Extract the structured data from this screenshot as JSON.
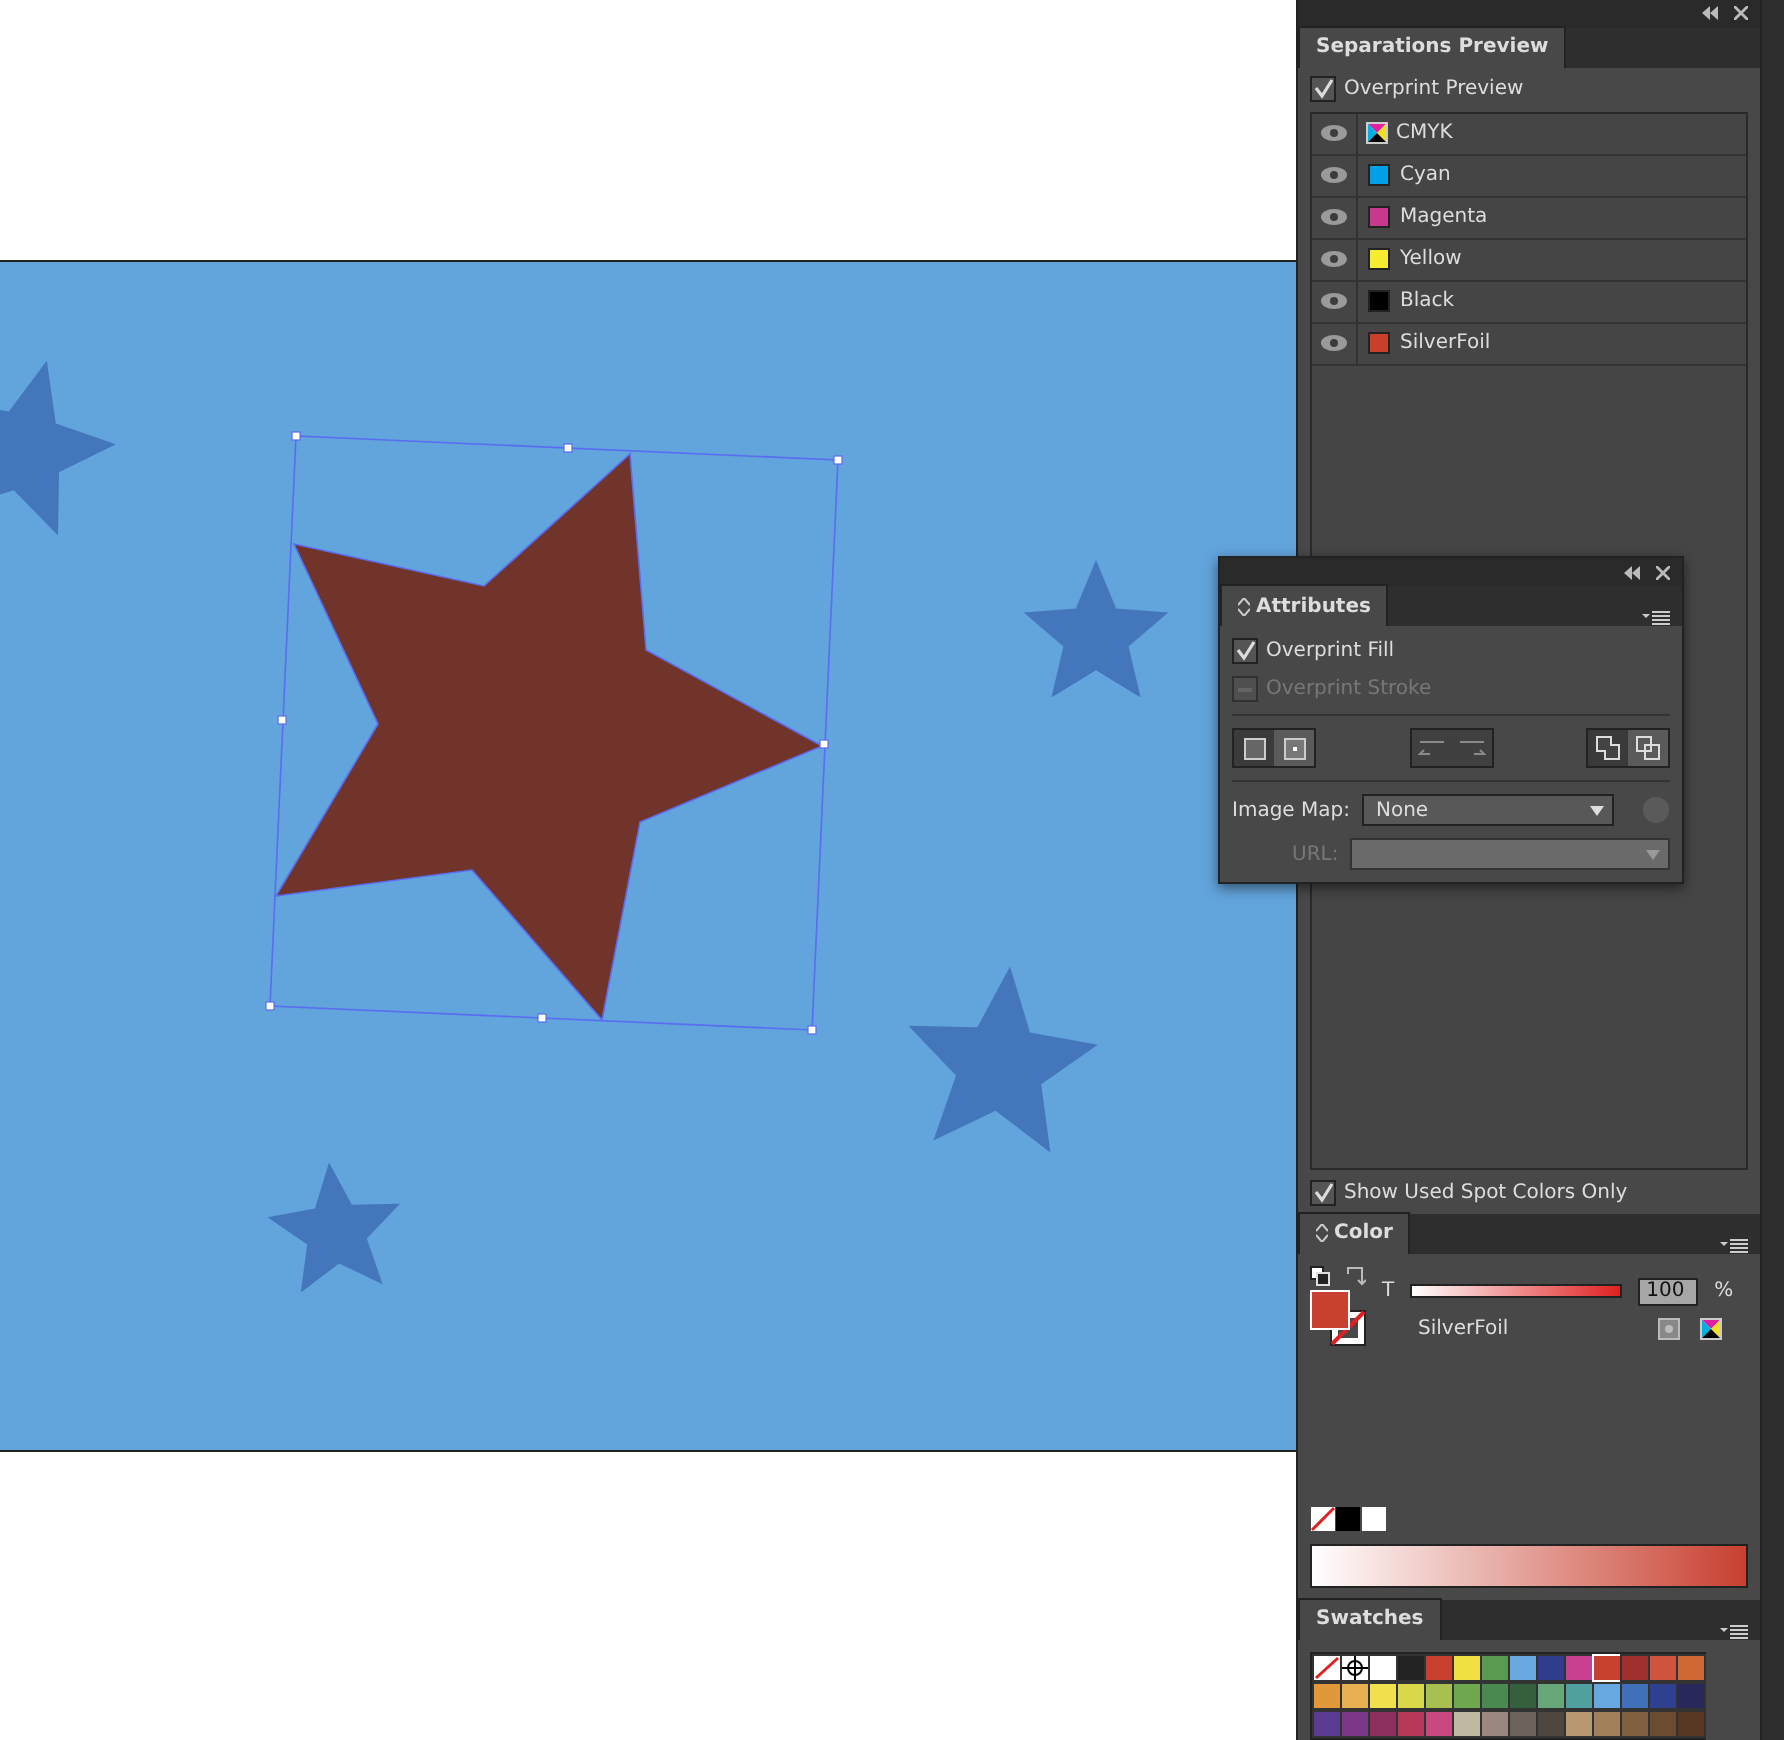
{
  "separations": {
    "title": "Separations Preview",
    "overprint_preview": {
      "label": "Overprint Preview",
      "checked": true
    },
    "inks": [
      {
        "name": "CMYK",
        "kind": "process",
        "visible": true
      },
      {
        "name": "Cyan",
        "kind": "ink",
        "color": "#00a0e6",
        "visible": true
      },
      {
        "name": "Magenta",
        "kind": "ink",
        "color": "#c8388c",
        "visible": true
      },
      {
        "name": "Yellow",
        "kind": "ink",
        "color": "#f8ec30",
        "visible": true
      },
      {
        "name": "Black",
        "kind": "ink",
        "color": "#000000",
        "visible": true
      },
      {
        "name": "SilverFoil",
        "kind": "ink",
        "color": "#c8402c",
        "visible": true
      }
    ],
    "show_used_spot": {
      "label": "Show Used Spot Colors Only",
      "checked": true
    }
  },
  "attributes": {
    "title": "Attributes",
    "overprint_fill": {
      "label": "Overprint Fill",
      "checked": true,
      "disabled": false
    },
    "overprint_stroke": {
      "label": "Overprint Stroke",
      "checked": false,
      "disabled": true
    },
    "image_map_label": "Image Map:",
    "image_map_value": "None",
    "url_label": "URL:"
  },
  "color": {
    "title": "Color",
    "tint_label": "T",
    "level": 1,
    "value": "100",
    "unit": "%",
    "swatch_name": "SilverFoil"
  },
  "swatches": {
    "title": "Swatches",
    "items": [
      {
        "kind": "none",
        "selected": false
      },
      {
        "kind": "registration",
        "selected": false
      },
      {
        "kind": "color",
        "color": "#ffffff",
        "selected": false
      },
      {
        "kind": "color",
        "color": "#222222",
        "selected": false
      },
      {
        "kind": "color",
        "color": "#c8412f",
        "selected": false
      },
      {
        "kind": "color",
        "color": "#f0e040",
        "selected": false
      },
      {
        "kind": "color",
        "color": "#5a9a50",
        "selected": false
      },
      {
        "kind": "color",
        "color": "#6aa8e0",
        "selected": false
      },
      {
        "kind": "color",
        "color": "#303c8c",
        "selected": false
      },
      {
        "kind": "color",
        "color": "#c84090",
        "selected": false
      },
      {
        "kind": "color",
        "color": "#c84030",
        "selected": true
      },
      {
        "kind": "color",
        "color": "#a03030",
        "selected": false
      },
      {
        "kind": "color",
        "color": "#d05540",
        "selected": false
      },
      {
        "kind": "color",
        "color": "#d06a35",
        "selected": false
      },
      {
        "kind": "color",
        "color": "#e0983a",
        "selected": false
      },
      {
        "kind": "color",
        "color": "#e8b050",
        "selected": false
      },
      {
        "kind": "color",
        "color": "#f0e050",
        "selected": false
      },
      {
        "kind": "color",
        "color": "#d8d848",
        "selected": false
      },
      {
        "kind": "color",
        "color": "#a8c050",
        "selected": false
      },
      {
        "kind": "color",
        "color": "#70a850",
        "selected": false
      },
      {
        "kind": "color",
        "color": "#4a8a50",
        "selected": false
      },
      {
        "kind": "color",
        "color": "#36603c",
        "selected": false
      },
      {
        "kind": "color",
        "color": "#68a878",
        "selected": false
      },
      {
        "kind": "color",
        "color": "#50a0a0",
        "selected": false
      },
      {
        "kind": "color",
        "color": "#68a8e0",
        "selected": false
      },
      {
        "kind": "color",
        "color": "#4070b8",
        "selected": false
      },
      {
        "kind": "color",
        "color": "#304090",
        "selected": false
      },
      {
        "kind": "color",
        "color": "#28285c",
        "selected": false
      },
      {
        "kind": "color",
        "color": "#5c3c90",
        "selected": false
      },
      {
        "kind": "color",
        "color": "#7c3888",
        "selected": false
      },
      {
        "kind": "color",
        "color": "#8c3060",
        "selected": false
      },
      {
        "kind": "color",
        "color": "#b83858",
        "selected": false
      },
      {
        "kind": "color",
        "color": "#c84880",
        "selected": false
      },
      {
        "kind": "color",
        "color": "#c0b8a0",
        "selected": false
      },
      {
        "kind": "color",
        "color": "#988880",
        "selected": false
      },
      {
        "kind": "color",
        "color": "#6c645c",
        "selected": false
      },
      {
        "kind": "color",
        "color": "#504640",
        "selected": false
      },
      {
        "kind": "color",
        "color": "#b89870",
        "selected": false
      },
      {
        "kind": "color",
        "color": "#a08058",
        "selected": false
      },
      {
        "kind": "color",
        "color": "#806040",
        "selected": false
      },
      {
        "kind": "color",
        "color": "#6c4c30",
        "selected": false
      },
      {
        "kind": "color",
        "color": "#583820",
        "selected": false
      }
    ]
  }
}
